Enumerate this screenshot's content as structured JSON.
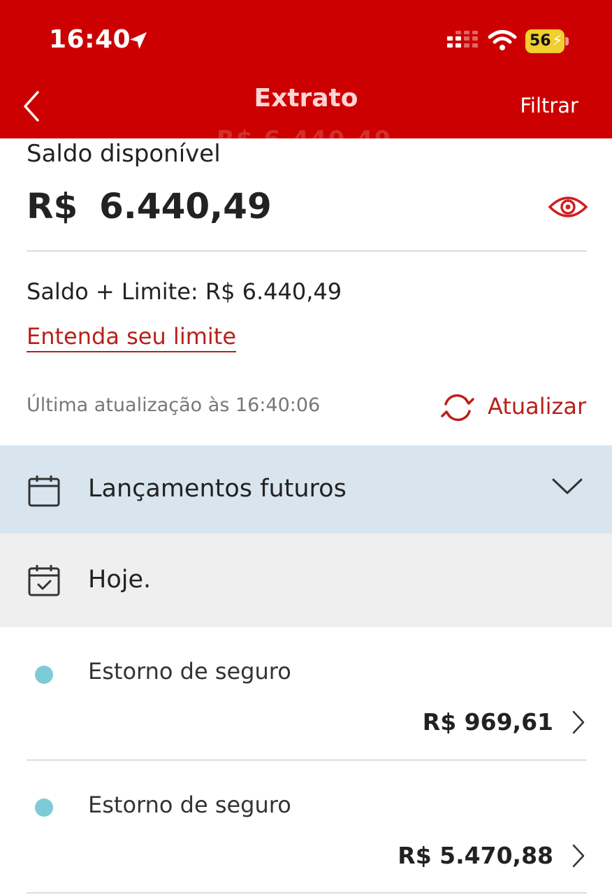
{
  "status_bar": {
    "time": "16:40",
    "battery": "56",
    "icons": [
      "location-arrow-icon",
      "signal-icon",
      "wifi-icon",
      "battery-icon"
    ]
  },
  "nav": {
    "title": "Extrato",
    "filter_label": "Filtrar",
    "ghost_amount": "R$ 6.440,49",
    "back_icon": "chevron-left-icon"
  },
  "balance": {
    "label": "Saldo disponível",
    "currency": "R$",
    "amount": "6.440,49",
    "visibility_icon": "eye-icon",
    "limit_text": "Saldo + Limite: R$  6.440,49",
    "limit_link": "Entenda seu limite",
    "last_update": "Última atualização às 16:40:06",
    "refresh_label": "Atualizar"
  },
  "sections": {
    "future_label": "Lançamentos futuros",
    "today_label": "Hoje."
  },
  "transactions": [
    {
      "description": "Estorno de seguro",
      "amount": "R$ 969,61"
    },
    {
      "description": "Estorno de seguro",
      "amount": "R$ 5.470,88"
    }
  ],
  "colors": {
    "brand_red": "#cc0000",
    "link_red": "#b8201a",
    "future_bg": "#d9e5ee",
    "today_bg": "#efefef",
    "dot": "#7ecbd8",
    "battery": "#f0cf2e"
  }
}
